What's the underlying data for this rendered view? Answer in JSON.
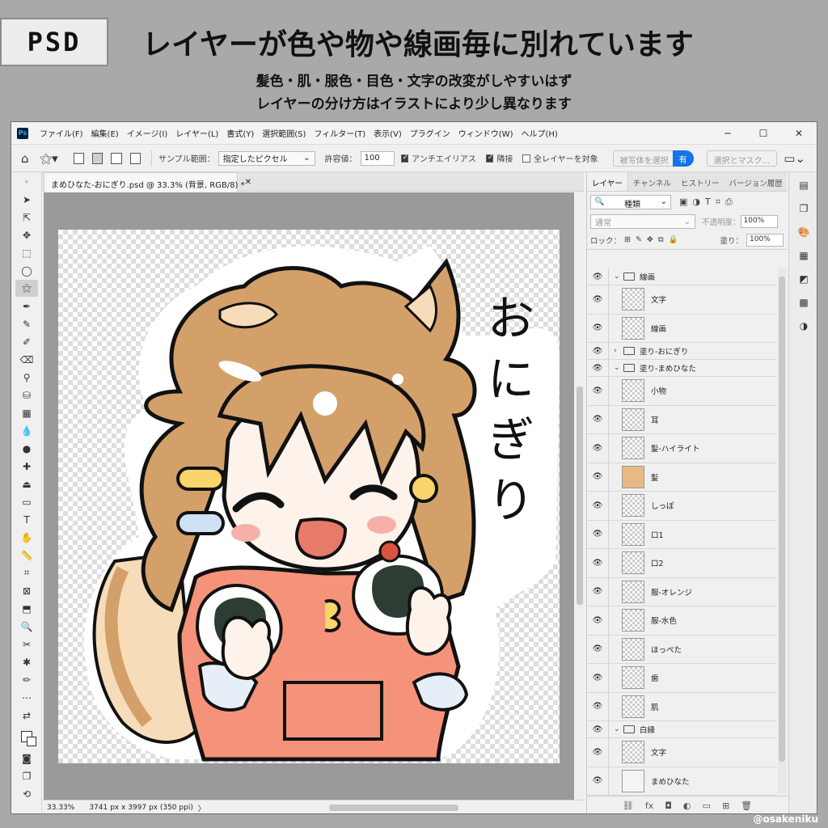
{
  "banner": {
    "tag": "PSD",
    "headline": "レイヤーが色や物や線画毎に別れています",
    "line1": "髪色・肌・服色・目色・文字の改変がしやすいはず",
    "line2": "レイヤーの分け方はイラストにより少し異なります"
  },
  "menubar": {
    "items": [
      "ファイル(F)",
      "編集(E)",
      "イメージ(I)",
      "レイヤー(L)",
      "書式(Y)",
      "選択範囲(S)",
      "フィルター(T)",
      "表示(V)",
      "プラグイン",
      "ウィンドウ(W)",
      "ヘルプ(H)"
    ],
    "min": "─",
    "max": "☐",
    "close": "✕"
  },
  "options": {
    "sample_label": "サンプル範囲：",
    "sample_value": "指定したピクセル",
    "tolerance_label": "許容値：",
    "tolerance_value": "100",
    "antialias": "アンチエイリアス",
    "contiguous": "隣接",
    "all_layers": "全レイヤーを対象",
    "subject_select": "被写体を選択",
    "share": "有",
    "select_mask": "選択とマスク..."
  },
  "document": {
    "tab": "まめひなた-おにぎり.psd @ 33.3% (背景, RGB/8) *",
    "zoom": "33.33%",
    "dims": "3741 px x 3997 px (350 ppi)"
  },
  "layers_panel": {
    "tabs": [
      "レイヤー",
      "チャンネル",
      "ヒストリー",
      "バージョン履歴"
    ],
    "kind": "種類",
    "blend": "通常",
    "opacity_label": "不透明度：",
    "opacity": "100%",
    "lock_label": "ロック：",
    "fill_label": "塗り：",
    "fill": "100%",
    "layers": [
      {
        "name": "線画",
        "type": "group",
        "open": true
      },
      {
        "name": "文字",
        "type": "layer"
      },
      {
        "name": "線画",
        "type": "layer"
      },
      {
        "name": "塗り-おにぎり",
        "type": "group",
        "open": false
      },
      {
        "name": "塗り-まめひなた",
        "type": "group",
        "open": true
      },
      {
        "name": "小物",
        "type": "layer"
      },
      {
        "name": "耳",
        "type": "layer"
      },
      {
        "name": "髪-ハイライト",
        "type": "layer"
      },
      {
        "name": "髪",
        "type": "layer"
      },
      {
        "name": "しっぽ",
        "type": "layer"
      },
      {
        "name": "口1",
        "type": "layer"
      },
      {
        "name": "口2",
        "type": "layer"
      },
      {
        "name": "服-オレンジ",
        "type": "layer"
      },
      {
        "name": "服-水色",
        "type": "layer"
      },
      {
        "name": "ほっぺた",
        "type": "layer"
      },
      {
        "name": "歯",
        "type": "layer"
      },
      {
        "name": "肌",
        "type": "layer"
      },
      {
        "name": "白縁",
        "type": "group",
        "open": true
      },
      {
        "name": "文字",
        "type": "layer"
      },
      {
        "name": "まめひなた",
        "type": "layer"
      }
    ]
  },
  "artwork": {
    "text": "おにぎり"
  },
  "credit": "@osakeniku",
  "colors": {
    "hair": "#d4a06a",
    "shirt": "#f4937a",
    "skin": "#fdf3ea",
    "nori": "#2e3d33",
    "outline": "#111111"
  }
}
